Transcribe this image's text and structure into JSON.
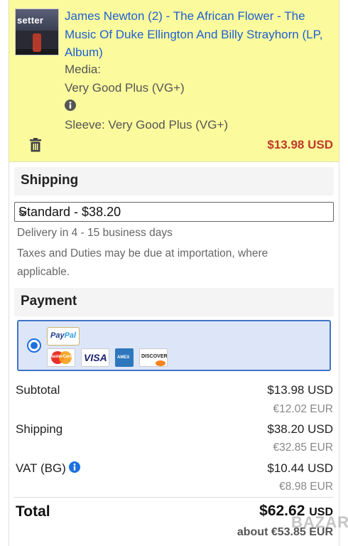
{
  "item": {
    "title": "James Newton (2) - The African Flower - The Music Of Duke Ellington And Billy Strayhorn (LP, Album)",
    "media_label": "Media:",
    "media_value": "Very Good Plus (VG+)",
    "sleeve": "Sleeve: Very Good Plus (VG+)",
    "price": "$13.98 USD",
    "thumb_text": "setter"
  },
  "shipping": {
    "heading": "Shipping",
    "selected_option": "Standard - $38.20",
    "delivery": "Delivery in 4 - 15 business days",
    "taxes_note_line1": "Taxes and Duties may be due at importation, where",
    "taxes_note_line2": "applicable."
  },
  "payment": {
    "heading": "Payment",
    "paypal_label_1": "Pay",
    "paypal_label_2": "Pal",
    "cards": [
      "MasterCard",
      "VISA",
      "AMEX",
      "DISCOVER"
    ]
  },
  "summary": {
    "subtotal_label": "Subtotal",
    "subtotal_usd": "$13.98 USD",
    "subtotal_eur": "€12.02 EUR",
    "shipping_label": "Shipping",
    "shipping_usd": "$38.20 USD",
    "shipping_eur": "€32.85 EUR",
    "vat_label": "VAT (BG)",
    "vat_usd": "$10.44 USD",
    "vat_eur": "€8.98 EUR",
    "total_label": "Total",
    "total_amount": "$62.62",
    "total_currency": "USD",
    "total_about": "about €53.85 EUR"
  },
  "watermark": "BAZAR",
  "colors": {
    "link": "#1f5fd1",
    "price": "#c0392b",
    "item_bg": "#fbfb9e",
    "info": "#1d6fe0"
  }
}
